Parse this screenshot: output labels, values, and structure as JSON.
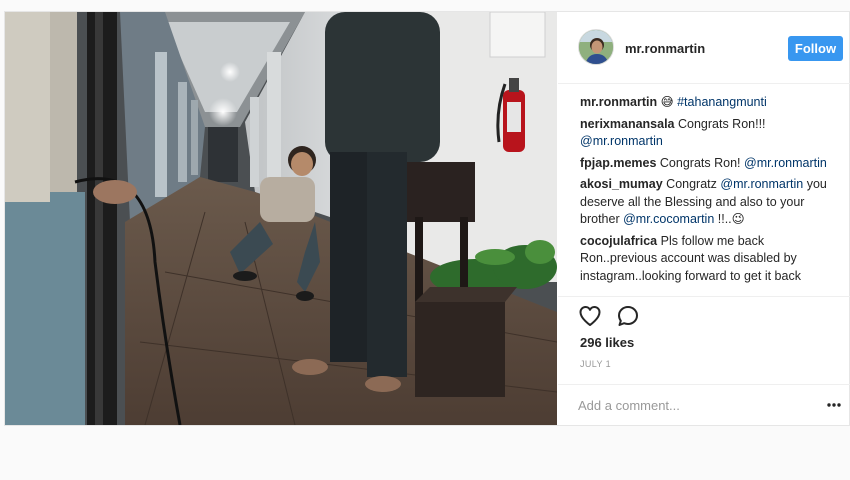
{
  "post": {
    "username": "mr.ronmartin",
    "follow_label": "Follow",
    "likes": "296 likes",
    "date": "JULY 1",
    "add_comment_placeholder": "Add a comment...",
    "caption": {
      "username": "mr.ronmartin",
      "emoji": "😅",
      "hashtag": "#tahanangmunti"
    }
  },
  "comments": [
    {
      "username": "nerixmanansala",
      "text": "Congrats Ron!!!",
      "mention": "@mr.ronmartin"
    },
    {
      "username": "fpjap.memes",
      "text": "Congrats Ron!",
      "mention": "@mr.ronmartin"
    },
    {
      "username": "akosi_mumay",
      "text1": "Congratz",
      "mention1": "@mr.ronmartin",
      "text2": "you deserve all the Blessing and also to your brother",
      "mention2": "@mr.cocomartin",
      "text3": "!!..",
      "emoji": "😉"
    },
    {
      "username": "cocojulafrica",
      "text": "Pls follow me back Ron..previous account was disabled by instagram..looking forward to get it back"
    }
  ],
  "icons": {
    "heart": "heart-icon",
    "comment": "comment-icon",
    "more": "more-options-icon",
    "avatar": "avatar"
  },
  "colors": {
    "accent": "#3897f0",
    "link": "#003569",
    "meta": "#999999"
  }
}
